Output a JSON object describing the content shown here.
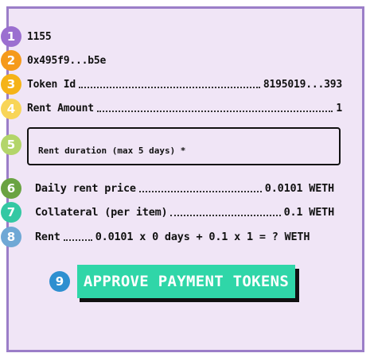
{
  "steps": [
    {
      "number": "1",
      "color": "#9b6fd0"
    },
    {
      "number": "2",
      "color": "#f59a1b"
    },
    {
      "number": "3",
      "color": "#f5b318"
    },
    {
      "number": "4",
      "color": "#f8d558"
    },
    {
      "number": "5",
      "color": "#b3d56a"
    },
    {
      "number": "6",
      "color": "#6aa342"
    },
    {
      "number": "7",
      "color": "#34c8a3"
    },
    {
      "number": "8",
      "color": "#6fa8d5"
    },
    {
      "number": "9",
      "color": "#2e8fd0"
    }
  ],
  "nft": {
    "id_short": "1155",
    "contract": "0x495f9...b5e"
  },
  "token_id": {
    "label": "Token Id",
    "value": "8195019...393"
  },
  "rent_amount": {
    "label": "Rent Amount",
    "value": "1"
  },
  "rent_duration": {
    "label": "Rent duration (max 5 days) *",
    "value": ""
  },
  "daily_price": {
    "label": "Daily rent price",
    "value": "0.0101 WETH"
  },
  "collateral": {
    "label": "Collateral (per item)",
    "value": "0.1 WETH"
  },
  "rent_total": {
    "label": "Rent",
    "formula": "0.0101 x 0 days + 0.1 x 1 = ? WETH"
  },
  "approve_button": {
    "label": "APPROVE PAYMENT TOKENS"
  }
}
